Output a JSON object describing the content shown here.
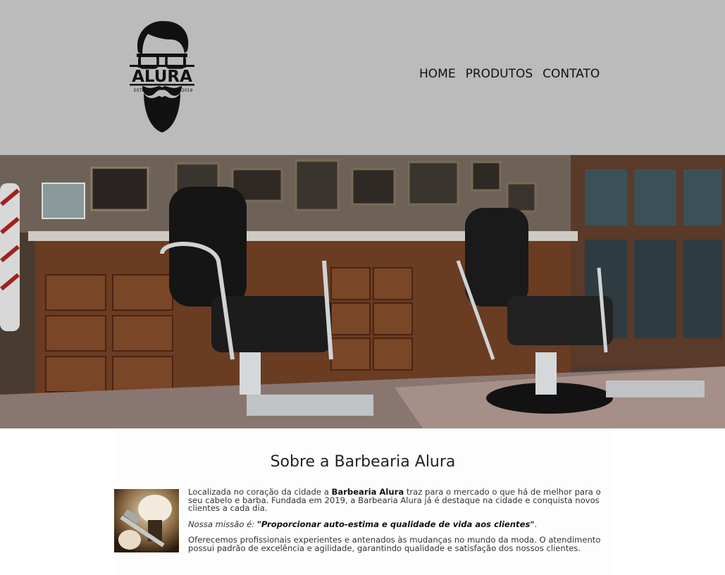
{
  "header": {
    "logo": {
      "icon": "bearded-man-glasses-logo",
      "brand": "ALURA",
      "estd_label": "ESTD",
      "year": "2019"
    },
    "nav": {
      "home": "HOME",
      "produtos": "PRODUTOS",
      "contato": "CONTATO"
    }
  },
  "hero": {
    "image": "barbershop-interior-two-barber-chairs"
  },
  "about": {
    "title": "Sobre a Barbearia Alura",
    "image": "shaving-brush-and-razor",
    "p1_before": "Localizada no coração da cidade a ",
    "p1_bold": "Barbearia Alura",
    "p1_after": " traz para o mercado o que há de melhor para o seu cabelo e barba. Fundada em 2019, a Barbearia Alura já é destaque na cidade e conquista novos clientes a cada dia.",
    "mission_label": "Nossa missão é: ",
    "mission_quote": "\"Proporcionar auto-estima e qualidade de vida aos clientes\"",
    "mission_end": ".",
    "p3": "Oferecemos profissionais experientes e antenados às mudanças no mundo da moda. O atendimento possui padrão de excelência e agilidade, garantindo qualidade e satisfação dos nossos clientes."
  },
  "colors": {
    "header_bg": "#bbbbbb",
    "nav_text": "#111111",
    "body_text": "#333333"
  }
}
